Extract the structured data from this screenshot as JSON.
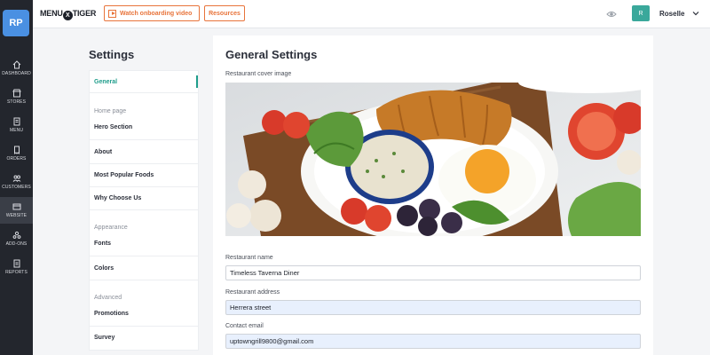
{
  "rail": {
    "logo": "RP",
    "items": [
      {
        "label": "DASHBOARD",
        "icon": "home-icon"
      },
      {
        "label": "STORES",
        "icon": "store-icon"
      },
      {
        "label": "MENU",
        "icon": "menu-icon"
      },
      {
        "label": "ORDERS",
        "icon": "orders-icon"
      },
      {
        "label": "CUSTOMERS",
        "icon": "customers-icon"
      },
      {
        "label": "WEBSITE",
        "icon": "website-icon"
      },
      {
        "label": "ADD-ONS",
        "icon": "addons-icon"
      },
      {
        "label": "REPORTS",
        "icon": "reports-icon"
      }
    ],
    "active": "WEBSITE"
  },
  "topbar": {
    "brand_left": "MENU",
    "brand_x": "X",
    "brand_right": "TIGER",
    "video_label": "Watch onboarding video",
    "resources_label": "Resources",
    "avatar_initial": "R",
    "username": "Roselle"
  },
  "settings": {
    "title": "Settings",
    "items": [
      {
        "label": "General"
      },
      {
        "group": "Home page"
      },
      {
        "label": "Hero Section"
      },
      {
        "label": "About"
      },
      {
        "label": "Most Popular Foods"
      },
      {
        "label": "Why Choose Us"
      },
      {
        "group": "Appearance"
      },
      {
        "label": "Fonts"
      },
      {
        "label": "Colors"
      },
      {
        "group": "Advanced"
      },
      {
        "label": "Promotions"
      },
      {
        "label": "Survey"
      }
    ]
  },
  "general": {
    "title": "General Settings",
    "cover_label": "Restaurant cover image",
    "name_label": "Restaurant name",
    "name_value": "Timeless Taverna Diner",
    "address_label": "Restaurant address",
    "address_value": "Herrera street",
    "email_label": "Contact email",
    "email_value": "uptowngrill9800@gmail.com"
  },
  "colors": {
    "accent": "#1f9d8b",
    "orange": "#e8743b",
    "rail_bg": "#23262d"
  }
}
